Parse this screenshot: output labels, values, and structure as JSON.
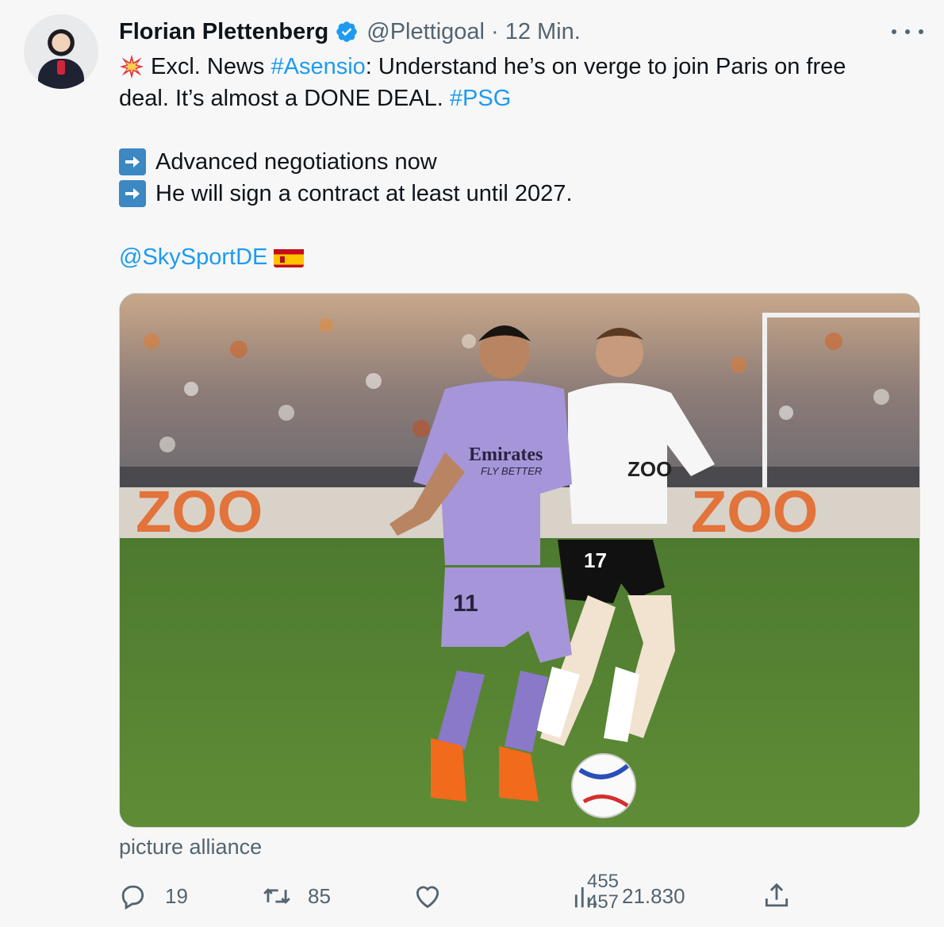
{
  "author": {
    "display_name": "Florian Plettenberg",
    "handle": "@Plettigoal",
    "separator": "·",
    "time": "12 Min."
  },
  "tweet": {
    "line1_prefix": "Excl. News ",
    "line1_tag": "#Asensio",
    "line1_rest": ": Understand he’s on verge to join Paris on free",
    "line2_text": "deal. It’s almost a DONE DEAL. ",
    "line2_tag": "#PSG",
    "bullet1": "Advanced negotiations now",
    "bullet2": "He will sign a contract at least until 2027.",
    "mention": "@SkySportDE",
    "emojis": [
      "collision-icon",
      "right-arrow-icon",
      "right-arrow-icon",
      "spain-flag-icon"
    ]
  },
  "media": {
    "caption": "picture alliance",
    "jersey_sponsor": "Emirates",
    "jersey_slogan": "FLY BETTER",
    "number_purple": "11",
    "number_white": "17",
    "board_text": "ZOO"
  },
  "actions": {
    "replies": "19",
    "retweets": "85",
    "likes_old": "455",
    "likes_new": "457",
    "views": "21.830"
  },
  "colors": {
    "link": "#1d9bf0",
    "muted": "#536471",
    "verified": "#1d9bf0",
    "background": "#f7f7f7"
  }
}
